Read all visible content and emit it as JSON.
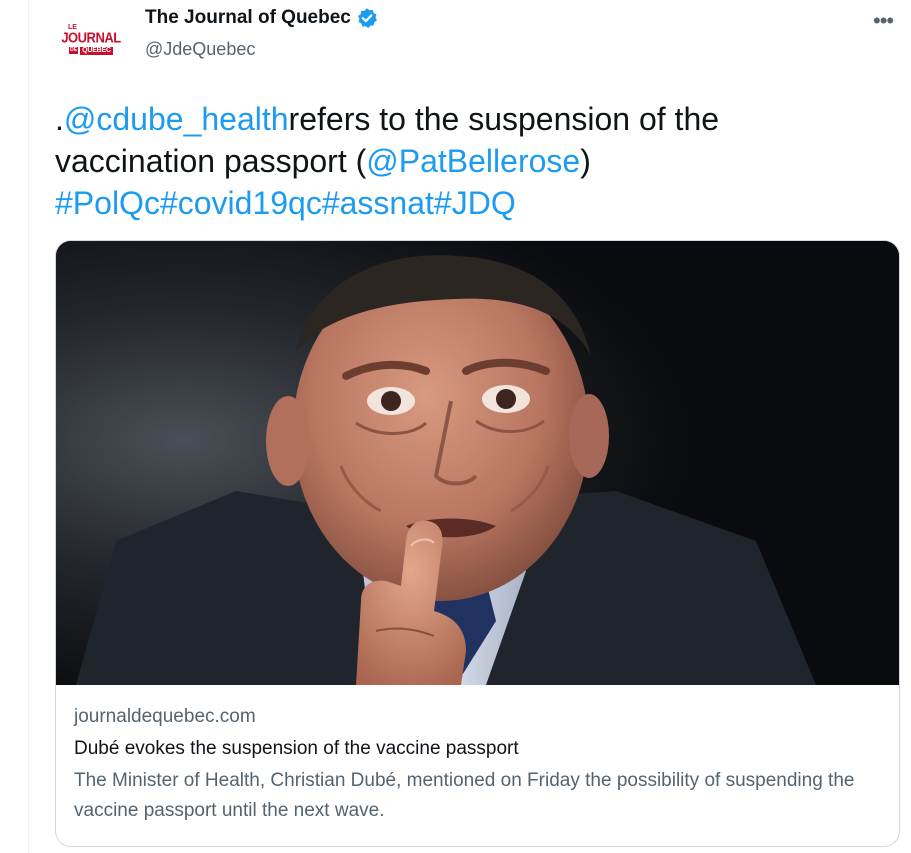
{
  "account": {
    "display_name": "The Journal of Quebec",
    "handle": "@JdeQuebec",
    "logo": {
      "small": "LE",
      "main": "JOURNAL",
      "de": "DE",
      "quebec": "QUÉBEC"
    }
  },
  "tweet": {
    "text_prefix": ".",
    "mention_1": "@cdube_health",
    "text_mid": "refers to the suspension of the vaccination passport (",
    "mention_2": "@PatBellerose",
    "text_end": ")",
    "hashtags": [
      "#PolQc",
      "#covid19qc",
      "#assnat",
      "#JDQ"
    ]
  },
  "card": {
    "domain": "journaldequebec.com",
    "title": "Dubé evokes the suspension of the vaccine passport",
    "description": "The Minister of Health, Christian Dubé, mentioned on Friday the possibility of suspending the vaccine passport until the next wave."
  },
  "icons": {
    "verified": "verified-badge-icon",
    "more": "more-options-icon"
  },
  "colors": {
    "link": "#1d9bf0",
    "text": "#0f1419",
    "secondary": "#536471",
    "brand_red": "#c8102e"
  }
}
